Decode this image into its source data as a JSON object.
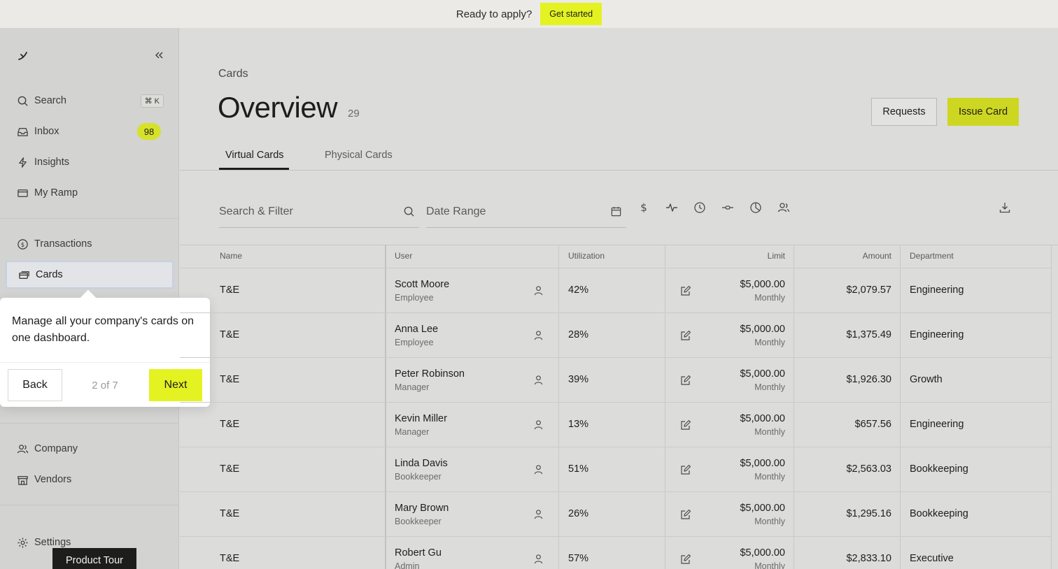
{
  "banner": {
    "text": "Ready to apply?",
    "cta": "Get started"
  },
  "sidebar": {
    "search": {
      "label": "Search",
      "shortcut": "⌘ K"
    },
    "inbox": {
      "label": "Inbox",
      "badge": "98"
    },
    "insights": {
      "label": "Insights"
    },
    "my_ramp": {
      "label": "My Ramp"
    },
    "transactions": {
      "label": "Transactions"
    },
    "cards": {
      "label": "Cards"
    },
    "company": {
      "label": "Company"
    },
    "vendors": {
      "label": "Vendors"
    },
    "settings": {
      "label": "Settings"
    }
  },
  "tour": {
    "message": "Manage all your company's cards on one dashboard.",
    "back": "Back",
    "step": "2 of 7",
    "next": "Next",
    "launcher": "Product Tour"
  },
  "main": {
    "breadcrumb": "Cards",
    "title": "Overview",
    "count": "29",
    "requests": "Requests",
    "issue_card": "Issue Card",
    "tabs": [
      {
        "label": "Virtual Cards"
      },
      {
        "label": "Physical Cards"
      }
    ],
    "search_placeholder": "Search & Filter",
    "date_placeholder": "Date Range"
  },
  "table": {
    "headers": {
      "name": "Name",
      "user": "User",
      "utilization": "Utilization",
      "limit": "Limit",
      "amount": "Amount",
      "department": "Department"
    },
    "rows": [
      {
        "name": "T&E",
        "user": "Scott Moore",
        "role": "Employee",
        "utilization": "42%",
        "limit": "$5,000.00",
        "period": "Monthly",
        "amount": "$2,079.57",
        "department": "Engineering"
      },
      {
        "name": "T&E",
        "user": "Anna Lee",
        "role": "Employee",
        "utilization": "28%",
        "limit": "$5,000.00",
        "period": "Monthly",
        "amount": "$1,375.49",
        "department": "Engineering"
      },
      {
        "name": "T&E",
        "user": "Peter Robinson",
        "role": "Manager",
        "utilization": "39%",
        "limit": "$5,000.00",
        "period": "Monthly",
        "amount": "$1,926.30",
        "department": "Growth"
      },
      {
        "name": "T&E",
        "user": "Kevin Miller",
        "role": "Manager",
        "utilization": "13%",
        "limit": "$5,000.00",
        "period": "Monthly",
        "amount": "$657.56",
        "department": "Engineering"
      },
      {
        "name": "T&E",
        "user": "Linda Davis",
        "role": "Bookkeeper",
        "utilization": "51%",
        "limit": "$5,000.00",
        "period": "Monthly",
        "amount": "$2,563.03",
        "department": "Bookkeeping"
      },
      {
        "name": "T&E",
        "user": "Mary Brown",
        "role": "Bookkeeper",
        "utilization": "26%",
        "limit": "$5,000.00",
        "period": "Monthly",
        "amount": "$1,295.16",
        "department": "Bookkeeping"
      },
      {
        "name": "T&E",
        "user": "Robert Gu",
        "role": "Admin",
        "utilization": "57%",
        "limit": "$5,000.00",
        "period": "Monthly",
        "amount": "$2,833.10",
        "department": "Executive"
      }
    ]
  }
}
